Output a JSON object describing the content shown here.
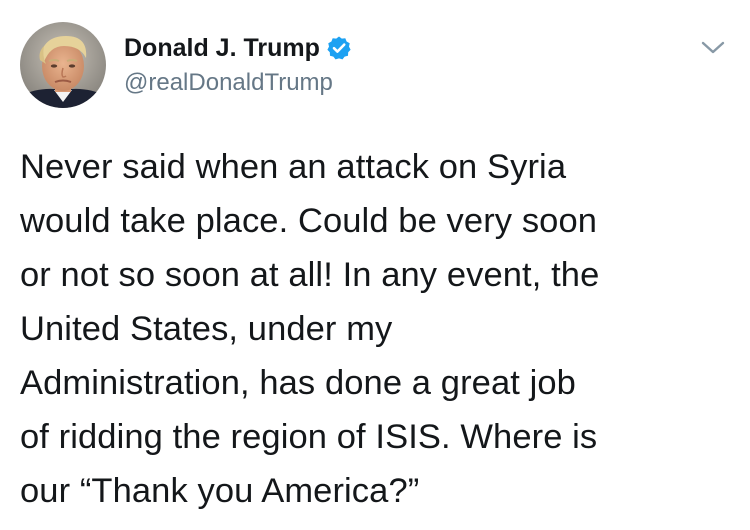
{
  "tweet": {
    "display_name": "Donald J. Trump",
    "handle": "@realDonaldTrump",
    "verified_icon": "verified-badge-icon",
    "menu_icon": "chevron-down-icon",
    "avatar_icon": "profile-photo",
    "accent_color": "#1da1f2",
    "text_lines": [
      "Never said when an attack on Syria",
      "would take place. Could be very soon",
      "or not so soon at all! In any event, the",
      "United States, under my",
      "Administration, has done a great job",
      "of ridding the region of ISIS. Where is",
      "our “Thank you America?”"
    ]
  }
}
